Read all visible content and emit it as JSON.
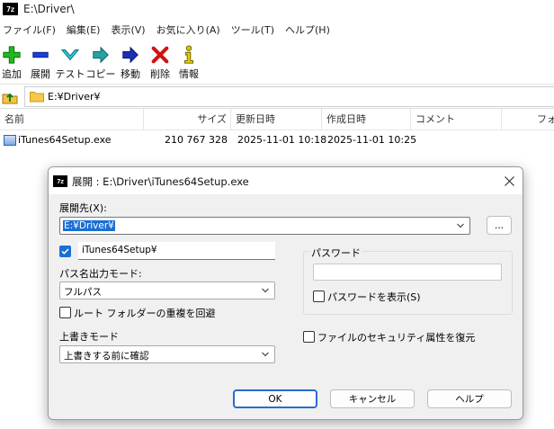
{
  "window": {
    "app_icon_text": "7z",
    "title": "E:\\Driver\\"
  },
  "menu": [
    {
      "label": "ファイル(F)"
    },
    {
      "label": "編集(E)"
    },
    {
      "label": "表示(V)"
    },
    {
      "label": "お気に入り(A)"
    },
    {
      "label": "ツール(T)"
    },
    {
      "label": "ヘルプ(H)"
    }
  ],
  "toolbar": {
    "add": "追加",
    "extract": "展開",
    "test": "テスト",
    "copy": "コピー",
    "move": "移動",
    "delete": "削除",
    "info": "情報"
  },
  "address": {
    "path": "E:¥Driver¥"
  },
  "columns": {
    "name": "名前",
    "size": "サイズ",
    "modified": "更新日時",
    "created": "作成日時",
    "comment": "コメント",
    "folder": "フォル"
  },
  "files": [
    {
      "name": "iTunes64Setup.exe",
      "size": "210 767 328",
      "modified": "2025-11-01 10:18",
      "created": "2025-11-01 10:25"
    }
  ],
  "dialog": {
    "icon_text": "7z",
    "title": "展開 : E:\\Driver\\iTunes64Setup.exe",
    "dest_label": "展開先(X):",
    "dest_value": "E:¥Driver¥",
    "browse_label": "...",
    "subfolder_value": "iTunes64Setup¥",
    "path_mode_label": "パス名出力モード:",
    "path_mode_value": "フルパス",
    "eliminate_dup_label": "ルート フォルダーの重複を回避",
    "overwrite_label": "上書きモード",
    "overwrite_value": "上書きする前に確認",
    "password_group": "パスワード",
    "password_value": "",
    "show_password_label": "パスワードを表示(S)",
    "restore_security_label": "ファイルのセキュリティ属性を復元",
    "ok": "OK",
    "cancel": "キャンセル",
    "help": "ヘルプ"
  },
  "colors": {
    "accent": "#1b6fd4",
    "selection": "#2a6bd0",
    "dialog_bg": "#f0f0f0"
  }
}
